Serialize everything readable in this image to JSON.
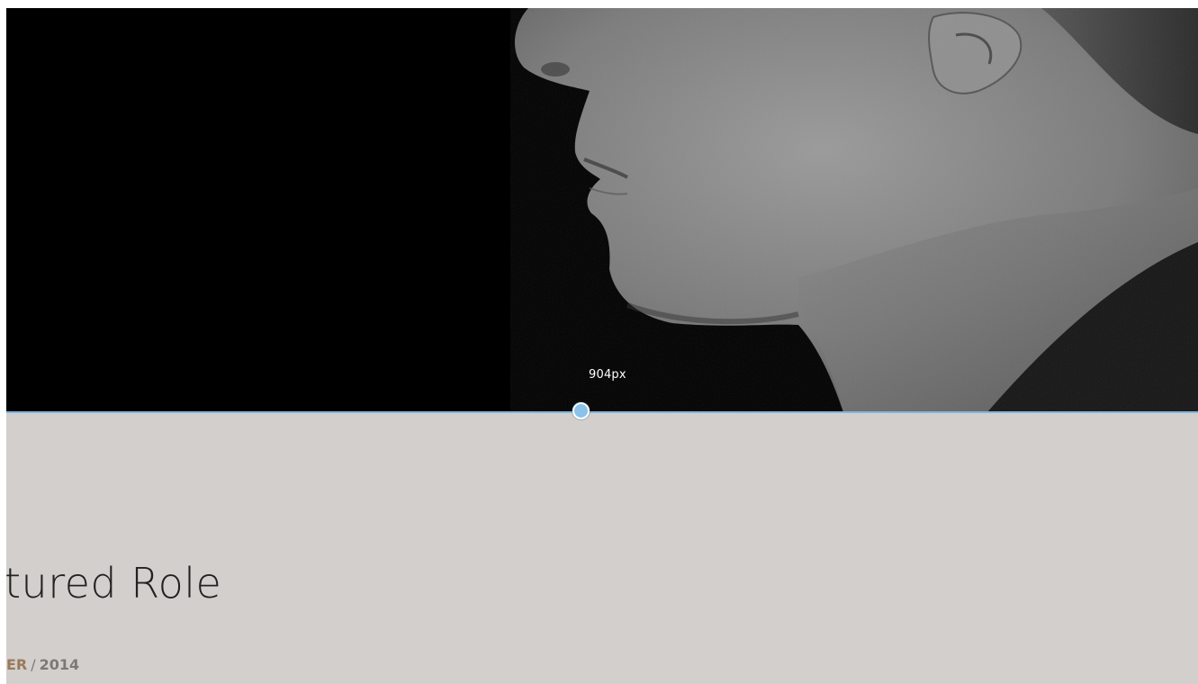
{
  "hero": {
    "image_label": "black-and-white profile portrait of a man's face",
    "background_color": "#000000"
  },
  "resize_tool": {
    "readout": "904px",
    "accent_color": "#8ac2ea"
  },
  "content": {
    "title": "tured Role",
    "meta_role": "ER",
    "meta_separator": "/",
    "meta_year": "2014",
    "background_color": "#d3cfcc"
  }
}
